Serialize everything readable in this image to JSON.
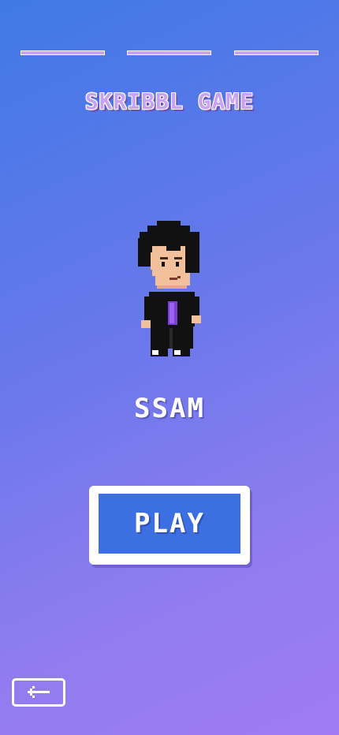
{
  "progress": {
    "total_steps": 3
  },
  "header": {
    "title": "SKRIBBL GAME"
  },
  "avatar": {
    "icon": "pixel-character-avatar-icon"
  },
  "player": {
    "name": "SSAM"
  },
  "actions": {
    "play_label": "PLAY",
    "back_icon": "arrow-left-icon"
  },
  "colors": {
    "background_start": "#3f79e6",
    "background_end": "#a07bf2",
    "title": "#c9a3f3",
    "play_button": "#3c6fe0",
    "progress_fill": "#c8a6ef",
    "white": "#ffffff"
  }
}
